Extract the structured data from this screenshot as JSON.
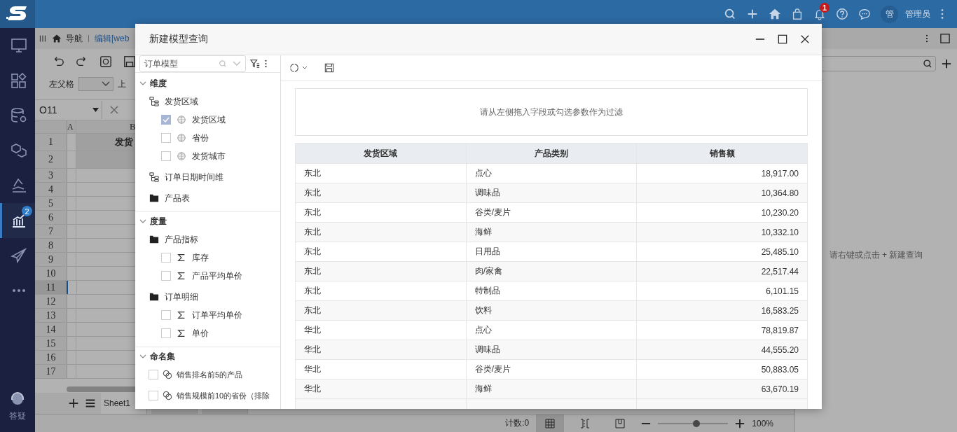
{
  "topbar": {
    "notification_count": "1",
    "avatar": "管",
    "user_name": "管理员"
  },
  "sidebar": {
    "items": [
      {
        "kind": "monitor",
        "selected": false
      },
      {
        "kind": "apps",
        "selected": false
      },
      {
        "kind": "database",
        "selected": false
      },
      {
        "kind": "cube",
        "selected": false
      },
      {
        "kind": "etl",
        "selected": false
      },
      {
        "kind": "analysis",
        "selected": true,
        "badge": "2"
      },
      {
        "kind": "send",
        "selected": false
      },
      {
        "kind": "more",
        "selected": false
      }
    ],
    "help_label": "答疑"
  },
  "workspace": {
    "breadcrumb": {
      "nav": "导航",
      "tab": "编辑[web"
    },
    "parent_label": "左父格",
    "cut_label": "上",
    "cell_ref": "O11",
    "columns": [
      "A",
      "B"
    ],
    "header_cell": "发货",
    "rows": [
      {
        "label": "1",
        "selected": false
      },
      {
        "label": "2",
        "selected": false
      },
      {
        "label": "3",
        "selected": false
      },
      {
        "label": "4",
        "selected": false
      },
      {
        "label": "5",
        "selected": false
      },
      {
        "label": "6",
        "selected": false
      },
      {
        "label": "7",
        "selected": false
      },
      {
        "label": "8",
        "selected": false
      },
      {
        "label": "9",
        "selected": false
      },
      {
        "label": "10",
        "selected": false
      },
      {
        "label": "11",
        "selected": true
      },
      {
        "label": "12",
        "selected": false
      },
      {
        "label": "13",
        "selected": false
      },
      {
        "label": "14",
        "selected": false
      },
      {
        "label": "15",
        "selected": false
      },
      {
        "label": "16",
        "selected": false
      },
      {
        "label": "17",
        "selected": false
      }
    ],
    "sheet_tabs": [
      {
        "label": "Sheet1",
        "selected": true
      }
    ],
    "status": {
      "count": "计数:0",
      "zoom": "100%",
      "level": 0.55
    }
  },
  "right_panel": {
    "hint": "请右键或点击 + 新建查询"
  },
  "dialog": {
    "title": "新建模型查询",
    "search": {
      "value": "订单模型"
    },
    "tree": [
      {
        "label": "维度",
        "expanded": true,
        "nodes": [
          {
            "kind": "hierarchy",
            "label": "发货区域",
            "children": [
              {
                "kind": "field",
                "label": "发货区域",
                "checked": true
              },
              {
                "kind": "field",
                "label": "省份",
                "checked": false
              },
              {
                "kind": "field",
                "label": "发货城市",
                "checked": false
              }
            ]
          },
          {
            "kind": "hierarchy",
            "label": "订单日期时间维"
          },
          {
            "kind": "folder",
            "label": "产品表"
          }
        ]
      },
      {
        "label": "度量",
        "expanded": true,
        "nodes": [
          {
            "kind": "folder",
            "label": "产品指标",
            "children": [
              {
                "kind": "measure",
                "label": "库存",
                "checked": false
              },
              {
                "kind": "measure",
                "label": "产品平均单价",
                "checked": false
              }
            ]
          },
          {
            "kind": "folder",
            "label": "订单明细",
            "children": [
              {
                "kind": "measure",
                "label": "订单平均单价",
                "checked": false
              },
              {
                "kind": "measure",
                "label": "单价",
                "checked": false
              }
            ]
          }
        ]
      },
      {
        "label": "命名集",
        "expanded": true,
        "nodes": [
          {
            "kind": "namedset",
            "label": "销售排名前5的产品",
            "checked": false
          },
          {
            "kind": "namedset",
            "label": "销售规模前10的省份（排除",
            "checked": false
          }
        ]
      }
    ],
    "filter_hint": "请从左侧拖入字段或勾选参数作为过滤",
    "table": {
      "columns": [
        "发货区域",
        "产品类别",
        "销售额"
      ],
      "rows": [
        [
          "东北",
          "点心",
          "18,917.00"
        ],
        [
          "东北",
          "调味品",
          "10,364.80"
        ],
        [
          "东北",
          "谷类/麦片",
          "10,230.20"
        ],
        [
          "东北",
          "海鲜",
          "10,332.10"
        ],
        [
          "东北",
          "日用品",
          "25,485.10"
        ],
        [
          "东北",
          "肉/家禽",
          "22,517.44"
        ],
        [
          "东北",
          "特制品",
          "6,101.15"
        ],
        [
          "东北",
          "饮料",
          "16,583.25"
        ],
        [
          "华北",
          "点心",
          "78,819.87"
        ],
        [
          "华北",
          "调味品",
          "44,555.20"
        ],
        [
          "华北",
          "谷类/麦片",
          "50,883.05"
        ],
        [
          "华北",
          "海鲜",
          "63,670.19"
        ]
      ]
    }
  }
}
